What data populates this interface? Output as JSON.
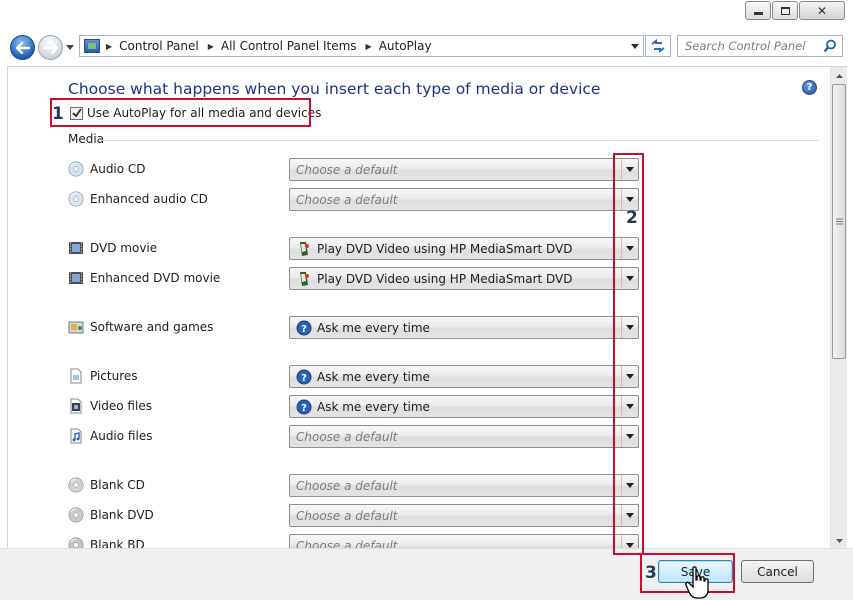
{
  "window": {
    "minimize": "minimize",
    "maximize": "maximize",
    "close": "close"
  },
  "breadcrumbs": [
    "Control Panel",
    "All Control Panel Items",
    "AutoPlay"
  ],
  "search": {
    "placeholder": "Search Control Panel"
  },
  "heading": "Choose what happens when you insert each type of media or device",
  "use_autoplay": {
    "label": "Use AutoPlay for all media and devices",
    "checked": true
  },
  "section": "Media",
  "rows": [
    {
      "label": "Audio CD",
      "icon": "audio-cd-icon",
      "value": "Choose a default",
      "placeholder": true
    },
    {
      "label": "Enhanced audio CD",
      "icon": "enhanced-audio-cd-icon",
      "value": "Choose a default",
      "placeholder": true
    },
    {
      "label": "DVD movie",
      "icon": "dvd-movie-icon",
      "value": "Play DVD Video using HP MediaSmart DVD",
      "placeholder": false,
      "value_icon": "hp-mediasmart-icon"
    },
    {
      "label": "Enhanced DVD movie",
      "icon": "enhanced-dvd-movie-icon",
      "value": "Play DVD Video using HP MediaSmart DVD",
      "placeholder": false,
      "value_icon": "hp-mediasmart-icon"
    },
    {
      "label": "Software and games",
      "icon": "software-games-icon",
      "value": "Ask me every time",
      "placeholder": false,
      "value_icon": "question-icon"
    },
    {
      "label": "Pictures",
      "icon": "pictures-icon",
      "value": "Ask me every time",
      "placeholder": false,
      "value_icon": "question-icon"
    },
    {
      "label": "Video files",
      "icon": "video-files-icon",
      "value": "Ask me every time",
      "placeholder": false,
      "value_icon": "question-icon"
    },
    {
      "label": "Audio files",
      "icon": "audio-files-icon",
      "value": "Choose a default",
      "placeholder": true
    },
    {
      "label": "Blank CD",
      "icon": "blank-cd-icon",
      "value": "Choose a default",
      "placeholder": true
    },
    {
      "label": "Blank DVD",
      "icon": "blank-dvd-icon",
      "value": "Choose a default",
      "placeholder": true
    },
    {
      "label": "Blank BD",
      "icon": "blank-bd-icon",
      "value": "Choose a default",
      "placeholder": true
    }
  ],
  "buttons": {
    "save": "Save",
    "cancel": "Cancel"
  },
  "annotations": {
    "step1": "1",
    "step2": "2",
    "step3": "3"
  },
  "colors": {
    "heading": "#1e3287",
    "annotation_box": "#c8102e",
    "annotation_number": "#23395d"
  }
}
